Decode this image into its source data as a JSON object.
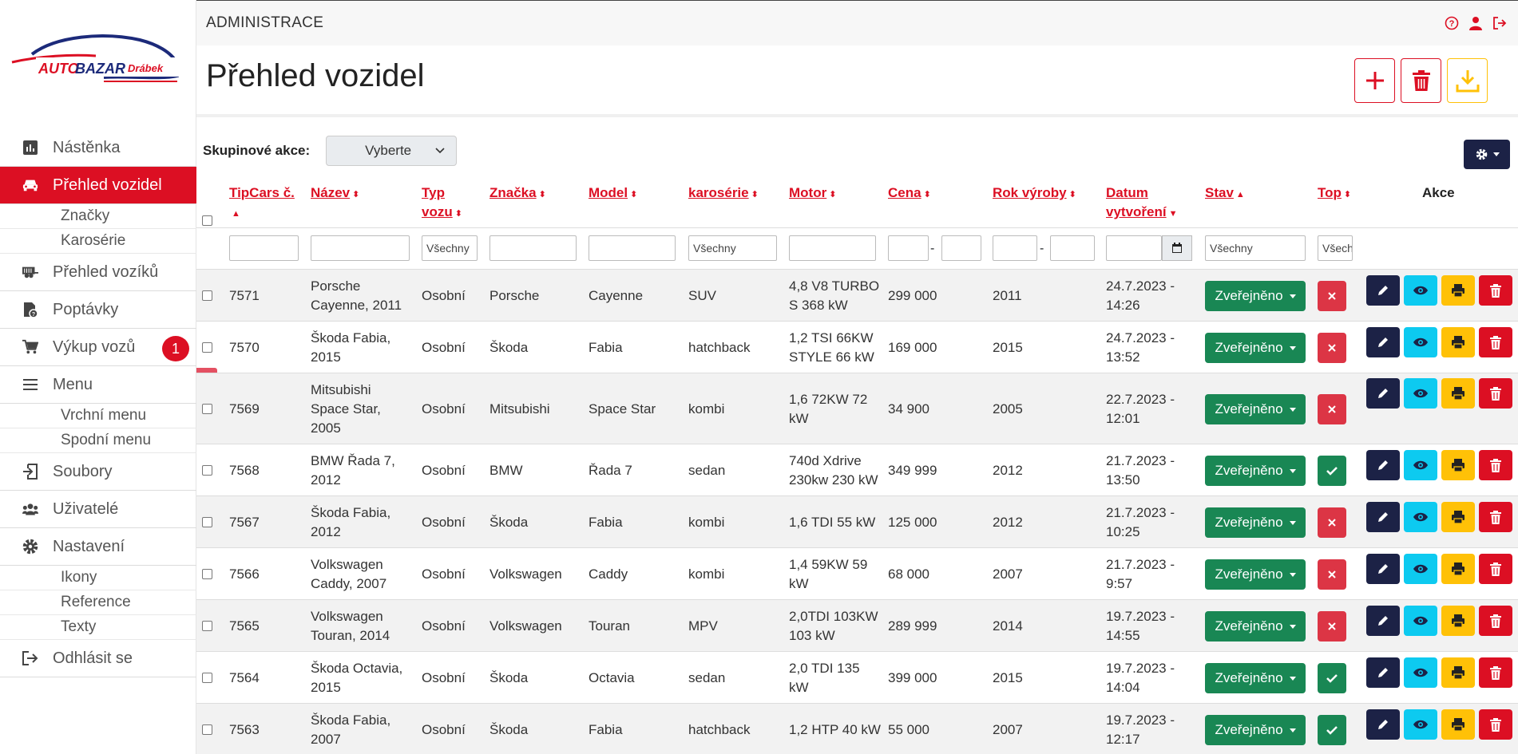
{
  "app": {
    "topbar_title": "ADMINISTRACE",
    "page_title": "Přehled vozidel",
    "logo_text": "AUTOBAZAR Drábek"
  },
  "colors": {
    "accent": "#dc0f23",
    "navy": "#1c2246",
    "success": "#198754",
    "info": "#0dcaf0",
    "warning": "#ffc107"
  },
  "sidebar": {
    "items": [
      {
        "label": "Nástěnka",
        "icon": "chart-icon"
      },
      {
        "label": "Přehled vozidel",
        "icon": "car-icon",
        "active": true
      },
      {
        "label": "Značky",
        "sub": true
      },
      {
        "label": "Karosérie",
        "sub": true
      },
      {
        "label": "Přehled vozíků",
        "icon": "trailer-icon"
      },
      {
        "label": "Poptávky",
        "icon": "inquiry-icon"
      },
      {
        "label": "Výkup vozů",
        "icon": "cart-icon",
        "badge": "1"
      },
      {
        "label": "Menu",
        "icon": "menu-icon"
      },
      {
        "label": "Vrchní menu",
        "sub": true
      },
      {
        "label": "Spodní menu",
        "sub": true
      },
      {
        "label": "Soubory",
        "icon": "files-icon"
      },
      {
        "label": "Uživatelé",
        "icon": "users-icon"
      },
      {
        "label": "Nastavení",
        "icon": "gear-icon"
      },
      {
        "label": "Ikony",
        "sub": true
      },
      {
        "label": "Reference",
        "sub": true
      },
      {
        "label": "Texty",
        "sub": true
      },
      {
        "label": "Odhlásit se",
        "icon": "logout-icon"
      }
    ]
  },
  "toolbar": {
    "group_label": "Skupinové akce:",
    "group_select": "Vyberte"
  },
  "table": {
    "headers": {
      "tipcars": "TipCars č.",
      "nazev": "Název",
      "typ1": "Typ",
      "typ2": "vozu",
      "znacka": "Značka",
      "model": "Model",
      "karoserie": "karosérie",
      "motor": "Motor",
      "cena": "Cena",
      "rok": "Rok výroby",
      "datum1": "Datum",
      "datum2": "vytvoření",
      "stav": "Stav",
      "top": "Top",
      "akce": "Akce"
    },
    "filters": {
      "typ": "Všechny",
      "karoserie": "Všechny",
      "stav": "Všechny",
      "top": "Všechn"
    },
    "status_label": "Zveřejněno",
    "rows": [
      {
        "id": "7571",
        "name1": "Porsche",
        "name2": "Cayenne, 2011",
        "type": "Osobní",
        "brand": "Porsche",
        "model": "Cayenne",
        "body": "SUV",
        "motor1": "4,8 V8 TURBO",
        "motor2": "S 368 kW",
        "motor3": "",
        "price": "299 000",
        "year": "2011",
        "date1": "24.7.2023 -",
        "date2": "14:26",
        "top": false
      },
      {
        "id": "7570",
        "name1": "Škoda Fabia,",
        "name2": "2015",
        "type": "Osobní",
        "brand": "Škoda",
        "model": "Fabia",
        "body": "hatchback",
        "motor1": "1,2 TSI 66KW",
        "motor2": "STYLE 66 kW",
        "motor3": "",
        "price": "169 000",
        "year": "2015",
        "date1": "24.7.2023 -",
        "date2": "13:52",
        "top": false
      },
      {
        "id": "7569",
        "name1": "Mitsubishi",
        "name2": "Space Star,",
        "name3": "2005",
        "type": "Osobní",
        "brand": "Mitsubishi",
        "model": "Space Star",
        "body": "kombi",
        "motor1": "1,6 72KW 72",
        "motor2": "kW",
        "motor3": "",
        "price": "34 900",
        "year": "2005",
        "date1": "22.7.2023 -",
        "date2": "12:01",
        "top": false
      },
      {
        "id": "7568",
        "name1": "BMW Řada 7,",
        "name2": "2012",
        "type": "Osobní",
        "brand": "BMW",
        "model": "Řada 7",
        "body": "sedan",
        "motor1": "740d Xdrive",
        "motor2": "230kw 230 kW",
        "motor3": "",
        "price": "349 999",
        "year": "2012",
        "date1": "21.7.2023 -",
        "date2": "13:50",
        "top": true
      },
      {
        "id": "7567",
        "name1": "Škoda Fabia,",
        "name2": "2012",
        "type": "Osobní",
        "brand": "Škoda",
        "model": "Fabia",
        "body": "kombi",
        "motor1": "1,6 TDI 55 kW",
        "motor2": "",
        "motor3": "",
        "price": "125 000",
        "year": "2012",
        "date1": "21.7.2023 -",
        "date2": "10:25",
        "top": false
      },
      {
        "id": "7566",
        "name1": "Volkswagen",
        "name2": "Caddy, 2007",
        "type": "Osobní",
        "brand": "Volkswagen",
        "model": "Caddy",
        "body": "kombi",
        "motor1": "1,4 59KW 59",
        "motor2": "kW",
        "motor3": "",
        "price": "68 000",
        "year": "2007",
        "date1": "21.7.2023 -",
        "date2": "9:57",
        "top": false
      },
      {
        "id": "7565",
        "name1": "Volkswagen",
        "name2": "Touran, 2014",
        "type": "Osobní",
        "brand": "Volkswagen",
        "model": "Touran",
        "body": "MPV",
        "motor1": "2,0TDI 103KW",
        "motor2": "103 kW",
        "motor3": "",
        "price": "289 999",
        "year": "2014",
        "date1": "19.7.2023 -",
        "date2": "14:55",
        "top": false
      },
      {
        "id": "7564",
        "name1": "Škoda Octavia,",
        "name2": "2015",
        "type": "Osobní",
        "brand": "Škoda",
        "model": "Octavia",
        "body": "sedan",
        "motor1": "2,0 TDI 135",
        "motor2": "kW",
        "motor3": "",
        "price": "399 000",
        "year": "2015",
        "date1": "19.7.2023 -",
        "date2": "14:04",
        "top": true
      },
      {
        "id": "7563",
        "name1": "Škoda Fabia,",
        "name2": "2007",
        "type": "Osobní",
        "brand": "Škoda",
        "model": "Fabia",
        "body": "hatchback",
        "motor1": "1,2 HTP 40 kW",
        "motor2": "",
        "motor3": "",
        "price": "55 000",
        "year": "2007",
        "date1": "19.7.2023 -",
        "date2": "12:17",
        "top": true
      }
    ]
  }
}
